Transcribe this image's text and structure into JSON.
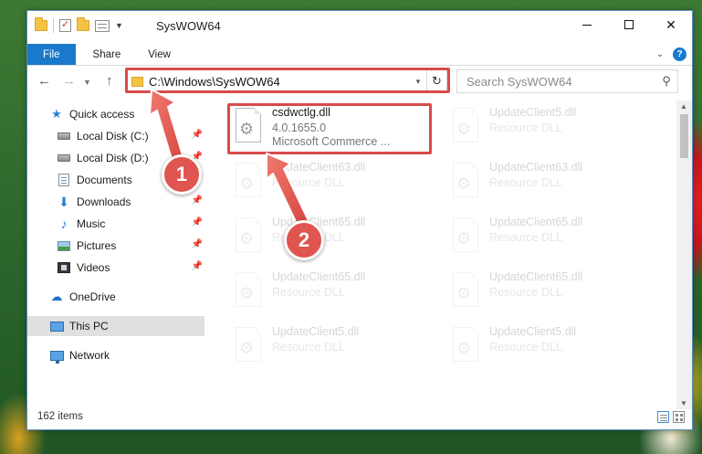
{
  "window": {
    "title": "SysWOW64"
  },
  "ribbon": {
    "tabs": [
      "File",
      "Share",
      "View"
    ],
    "help_label": "?"
  },
  "nav": {
    "address": "C:\\Windows\\SysWOW64",
    "search_placeholder": "Search SysWOW64"
  },
  "sidebar": {
    "items": [
      {
        "label": "Quick access",
        "icon": "star-icon",
        "pinned": false
      },
      {
        "label": "Local Disk (C:)",
        "icon": "drive-icon",
        "pinned": true
      },
      {
        "label": "Local Disk (D:)",
        "icon": "drive-icon",
        "pinned": true
      },
      {
        "label": "Documents",
        "icon": "documents-icon",
        "pinned": true
      },
      {
        "label": "Downloads",
        "icon": "download-icon",
        "pinned": true
      },
      {
        "label": "Music",
        "icon": "music-icon",
        "pinned": true
      },
      {
        "label": "Pictures",
        "icon": "pictures-icon",
        "pinned": true
      },
      {
        "label": "Videos",
        "icon": "videos-icon",
        "pinned": true
      },
      {
        "label": "OneDrive",
        "icon": "cloud-icon",
        "pinned": false
      },
      {
        "label": "This PC",
        "icon": "computer-icon",
        "pinned": false,
        "selected": true
      },
      {
        "label": "Network",
        "icon": "network-icon",
        "pinned": false
      }
    ]
  },
  "files": [
    {
      "name": "csdwctlg.dll",
      "line2": "4.0.1655.0",
      "line3": "Microsoft Commerce ..."
    },
    {
      "name": "UpdateClient5.dll",
      "line2": "Resource DLL"
    },
    {
      "name": "UpdateClient63.dll",
      "line2": "Resource DLL"
    },
    {
      "name": "UpdateClient63.dll",
      "line2": "Resource DLL"
    },
    {
      "name": "UpdateClient65.dll",
      "line2": "Resource DLL"
    },
    {
      "name": "UpdateClient65.dll",
      "line2": "Resource DLL"
    },
    {
      "name": "UpdateClient65.dll",
      "line2": "Resource DLL"
    },
    {
      "name": "UpdateClient65.dll",
      "line2": "Resource DLL"
    },
    {
      "name": "UpdateClient5.dll",
      "line2": "Resource DLL"
    },
    {
      "name": "UpdateClient5.dll",
      "line2": "Resource DLL"
    }
  ],
  "status": {
    "item_count": "162 items"
  },
  "annotations": {
    "step1": "1",
    "step2": "2",
    "highlight_color": "#d94a4a",
    "badge_color": "#e0554f"
  },
  "colors": {
    "accent": "#1979ca",
    "selected_nav": "#e0e0e0"
  }
}
